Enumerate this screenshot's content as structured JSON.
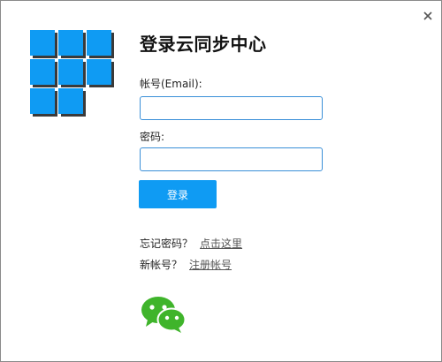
{
  "window": {
    "title": "登录云同步中心",
    "close_icon": "close-icon"
  },
  "form": {
    "account_label": "帐号(Email):",
    "account_value": "",
    "password_label": "密码:",
    "password_value": "",
    "login_label": "登录"
  },
  "links": {
    "forgot_prefix": "忘记密码？",
    "forgot_link": "点击这里",
    "new_prefix": "新帐号？",
    "register_link": "注册帐号"
  },
  "icons": {
    "logo": "app-logo-icon",
    "wechat": "wechat-icon"
  },
  "colors": {
    "accent": "#0f9bf3",
    "input_border": "#3a8fd8",
    "wechat_green": "#3fb42b"
  }
}
